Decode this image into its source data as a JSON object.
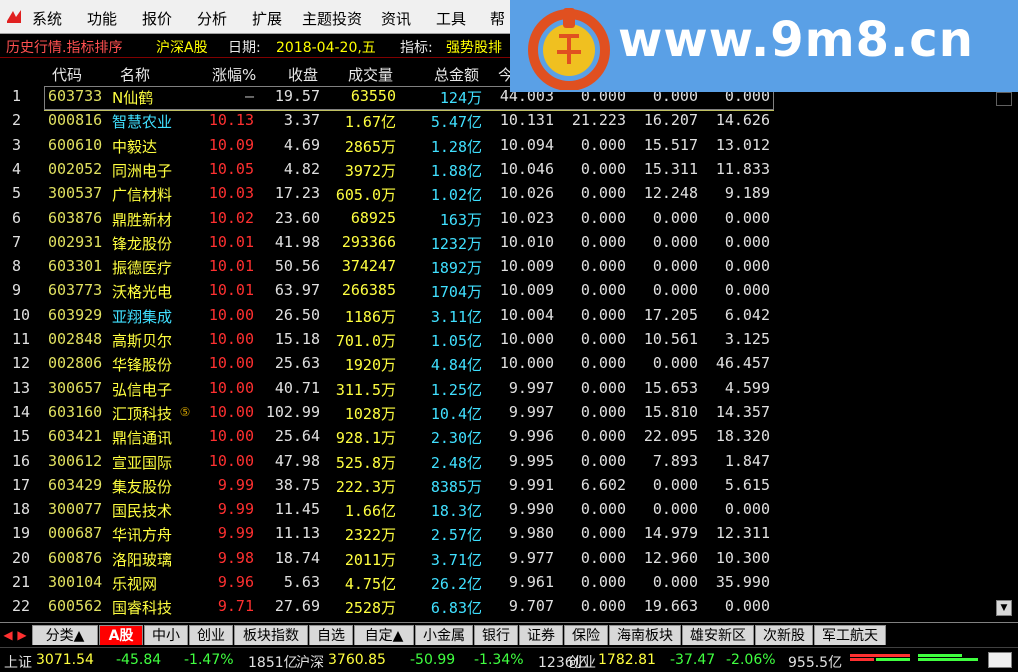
{
  "menu": {
    "items": [
      "系统",
      "功能",
      "报价",
      "分析",
      "扩展",
      "主题投资",
      "资讯",
      "工具",
      "帮"
    ]
  },
  "watermark": {
    "url": "www.9m8.cn"
  },
  "titlebar": {
    "mode": "历史行情.指标排序",
    "market": "沪深A股",
    "date_label": "日期:",
    "date": "2018-04-20,五",
    "indicator_label": "指标:",
    "indicator": "强势股排"
  },
  "table": {
    "headers": {
      "code": "代码",
      "name": "名称",
      "pct": "涨幅%",
      "close": "收盘",
      "volume": "成交量",
      "amount": "总金额",
      "today": "今"
    },
    "rows": [
      {
        "num": "1",
        "code": "603733",
        "name": "N仙鹤",
        "pct": "—",
        "close": "19.57",
        "volume": "63550",
        "amount": "124万",
        "today": "44.003",
        "c7": "0.000",
        "c8": "0.000",
        "c9": "0.000"
      },
      {
        "num": "2",
        "code": "000816",
        "name": "智慧农业",
        "pct": "10.13",
        "close": "3.37",
        "volume": "1.67亿",
        "amount": "5.47亿",
        "today": "10.131",
        "c7": "21.223",
        "c8": "16.207",
        "c9": "14.626"
      },
      {
        "num": "3",
        "code": "600610",
        "name": "中毅达",
        "pct": "10.09",
        "close": "4.69",
        "volume": "2865万",
        "amount": "1.28亿",
        "today": "10.094",
        "c7": "0.000",
        "c8": "15.517",
        "c9": "13.012"
      },
      {
        "num": "4",
        "code": "002052",
        "name": "同洲电子",
        "pct": "10.05",
        "close": "4.82",
        "volume": "3972万",
        "amount": "1.88亿",
        "today": "10.046",
        "c7": "0.000",
        "c8": "15.311",
        "c9": "11.833"
      },
      {
        "num": "5",
        "code": "300537",
        "name": "广信材料",
        "pct": "10.03",
        "close": "17.23",
        "volume": "605.0万",
        "amount": "1.02亿",
        "today": "10.026",
        "c7": "0.000",
        "c8": "12.248",
        "c9": "9.189"
      },
      {
        "num": "6",
        "code": "603876",
        "name": "鼎胜新材",
        "pct": "10.02",
        "close": "23.60",
        "volume": "68925",
        "amount": "163万",
        "today": "10.023",
        "c7": "0.000",
        "c8": "0.000",
        "c9": "0.000"
      },
      {
        "num": "7",
        "code": "002931",
        "name": "锋龙股份",
        "pct": "10.01",
        "close": "41.98",
        "volume": "293366",
        "amount": "1232万",
        "today": "10.010",
        "c7": "0.000",
        "c8": "0.000",
        "c9": "0.000"
      },
      {
        "num": "8",
        "code": "603301",
        "name": "振德医疗",
        "pct": "10.01",
        "close": "50.56",
        "volume": "374247",
        "amount": "1892万",
        "today": "10.009",
        "c7": "0.000",
        "c8": "0.000",
        "c9": "0.000"
      },
      {
        "num": "9",
        "code": "603773",
        "name": "沃格光电",
        "pct": "10.01",
        "close": "63.97",
        "volume": "266385",
        "amount": "1704万",
        "today": "10.009",
        "c7": "0.000",
        "c8": "0.000",
        "c9": "0.000"
      },
      {
        "num": "10",
        "code": "603929",
        "name": "亚翔集成",
        "pct": "10.00",
        "close": "26.50",
        "volume": "1186万",
        "amount": "3.11亿",
        "today": "10.004",
        "c7": "0.000",
        "c8": "17.205",
        "c9": "6.042"
      },
      {
        "num": "11",
        "code": "002848",
        "name": "高斯贝尔",
        "pct": "10.00",
        "close": "15.18",
        "volume": "701.0万",
        "amount": "1.05亿",
        "today": "10.000",
        "c7": "0.000",
        "c8": "10.561",
        "c9": "3.125"
      },
      {
        "num": "12",
        "code": "002806",
        "name": "华锋股份",
        "pct": "10.00",
        "close": "25.63",
        "volume": "1920万",
        "amount": "4.84亿",
        "today": "10.000",
        "c7": "0.000",
        "c8": "0.000",
        "c9": "46.457"
      },
      {
        "num": "13",
        "code": "300657",
        "name": "弘信电子",
        "pct": "10.00",
        "close": "40.71",
        "volume": "311.5万",
        "amount": "1.25亿",
        "today": "9.997",
        "c7": "0.000",
        "c8": "15.653",
        "c9": "4.599"
      },
      {
        "num": "14",
        "code": "603160",
        "name": "汇顶科技",
        "pct": "10.00",
        "close": "102.99",
        "volume": "1028万",
        "amount": "10.4亿",
        "today": "9.997",
        "c7": "0.000",
        "c8": "15.810",
        "c9": "14.357"
      },
      {
        "num": "15",
        "code": "603421",
        "name": "鼎信通讯",
        "pct": "10.00",
        "close": "25.64",
        "volume": "928.1万",
        "amount": "2.30亿",
        "today": "9.996",
        "c7": "0.000",
        "c8": "22.095",
        "c9": "18.320"
      },
      {
        "num": "16",
        "code": "300612",
        "name": "宣亚国际",
        "pct": "10.00",
        "close": "47.98",
        "volume": "525.8万",
        "amount": "2.48亿",
        "today": "9.995",
        "c7": "0.000",
        "c8": "7.893",
        "c9": "1.847"
      },
      {
        "num": "17",
        "code": "603429",
        "name": "集友股份",
        "pct": "9.99",
        "close": "38.75",
        "volume": "222.3万",
        "amount": "8385万",
        "today": "9.991",
        "c7": "6.602",
        "c8": "0.000",
        "c9": "5.615"
      },
      {
        "num": "18",
        "code": "300077",
        "name": "国民技术",
        "pct": "9.99",
        "close": "11.45",
        "volume": "1.66亿",
        "amount": "18.3亿",
        "today": "9.990",
        "c7": "0.000",
        "c8": "0.000",
        "c9": "0.000"
      },
      {
        "num": "19",
        "code": "000687",
        "name": "华讯方舟",
        "pct": "9.99",
        "close": "11.13",
        "volume": "2322万",
        "amount": "2.57亿",
        "today": "9.980",
        "c7": "0.000",
        "c8": "14.979",
        "c9": "12.311"
      },
      {
        "num": "20",
        "code": "600876",
        "name": "洛阳玻璃",
        "pct": "9.98",
        "close": "18.74",
        "volume": "2011万",
        "amount": "3.71亿",
        "today": "9.977",
        "c7": "0.000",
        "c8": "12.960",
        "c9": "10.300"
      },
      {
        "num": "21",
        "code": "300104",
        "name": "乐视网",
        "pct": "9.96",
        "close": "5.63",
        "volume": "4.75亿",
        "amount": "26.2亿",
        "today": "9.961",
        "c7": "0.000",
        "c8": "0.000",
        "c9": "35.990"
      },
      {
        "num": "22",
        "code": "600562",
        "name": "国睿科技",
        "pct": "9.71",
        "close": "27.69",
        "volume": "2528万",
        "amount": "6.83亿",
        "today": "9.707",
        "c7": "0.000",
        "c8": "19.663",
        "c9": "0.000"
      }
    ],
    "cyan_names": [
      1,
      9
    ]
  },
  "tabs": [
    "分类▲",
    "A股",
    "中小",
    "创业",
    "板块指数",
    "自选",
    "自定▲",
    "小金属",
    "银行",
    "证券",
    "保险",
    "海南板块",
    "雄安新区",
    "次新股",
    "军工航天"
  ],
  "active_tab": 1,
  "status": {
    "sh_label": "上证",
    "sh_value": "3071.54",
    "sh_change": "-45.84",
    "sh_pct": "-1.47%",
    "sh_amount": "1851亿",
    "hs_label": "沪深",
    "hs_value": "3760.85",
    "hs_change": "-50.99",
    "hs_pct": "-1.34%",
    "hs_amount": "1236亿",
    "cy_label": "创业",
    "cy_value": "1782.81",
    "cy_change": "-37.47",
    "cy_pct": "-2.06%",
    "cy_amount": "955.5亿"
  }
}
